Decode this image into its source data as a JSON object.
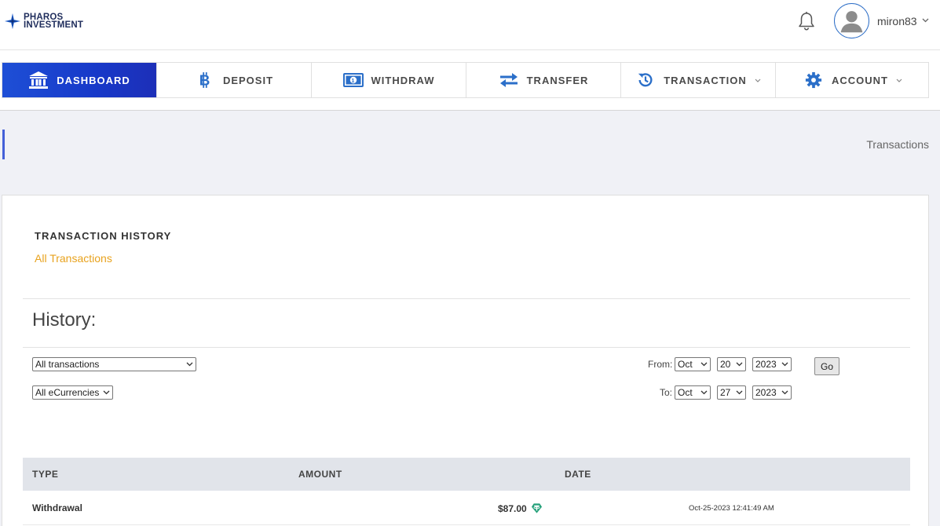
{
  "header": {
    "logo": {
      "line1": "PHAROS",
      "line2": "INVESTMENT",
      "icon": "compass-star-icon"
    },
    "notifications_icon": "bell-icon",
    "user": {
      "name": "miron83",
      "avatar_icon": "user-avatar-icon"
    }
  },
  "nav": {
    "items": [
      {
        "label": "DASHBOARD",
        "icon": "bank-icon",
        "active": true
      },
      {
        "label": "DEPOSIT",
        "icon": "bitcoin-icon"
      },
      {
        "label": "WITHDRAW",
        "icon": "money-bill-icon"
      },
      {
        "label": "TRANSFER",
        "icon": "exchange-arrows-icon"
      },
      {
        "label": "TRANSACTION",
        "icon": "history-icon",
        "dropdown": true
      },
      {
        "label": "ACCOUNT",
        "icon": "gear-icon",
        "dropdown": true
      }
    ]
  },
  "breadcrumb": {
    "current": "Transactions"
  },
  "card": {
    "title": "TRANSACTION HISTORY",
    "subtitle": "All Transactions",
    "history_heading": "History:"
  },
  "filters": {
    "type_select": "All transactions",
    "currency_select": "All eCurrencies",
    "from_label": "From:",
    "from": {
      "month": "Oct",
      "day": "20",
      "year": "2023"
    },
    "to_label": "To:",
    "to": {
      "month": "Oct",
      "day": "27",
      "year": "2023"
    },
    "go_label": "Go"
  },
  "table": {
    "columns": [
      "TYPE",
      "AMOUNT",
      "DATE"
    ],
    "rows": [
      {
        "type": "Withdrawal",
        "amount": "$87.00",
        "currency_icon": "tether-icon",
        "date": "Oct-25-2023 12:41:49 AM"
      }
    ]
  },
  "colors": {
    "accent": "#1e4fd6",
    "link_orange": "#e8a21d",
    "icon_blue": "#2b6fc9",
    "tether_green": "#26a17b"
  }
}
